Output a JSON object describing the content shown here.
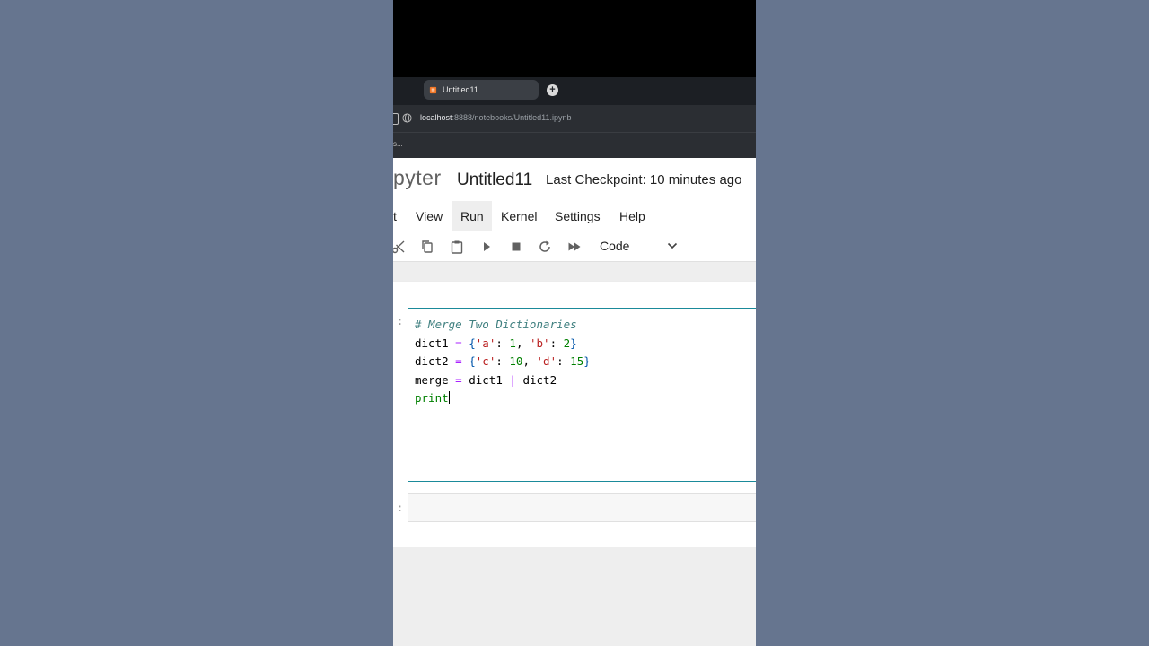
{
  "browser": {
    "tab_title": "Untitled11",
    "new_tab_symbol": "+",
    "url_host": "localhost",
    "url_path": ":8888/notebooks/Untitled11.ipynb",
    "bookmark_text": "s..."
  },
  "jupyter": {
    "logo_text": "pyter",
    "notebook_title": "Untitled11",
    "checkpoint": "Last Checkpoint: 10 minutes ago",
    "menu": {
      "edit_partial": "t",
      "view": "View",
      "run": "Run",
      "kernel": "Kernel",
      "settings": "Settings",
      "help": "Help"
    },
    "toolbar": {
      "cell_type": "Code",
      "icons": [
        "cut-icon",
        "copy-icon",
        "paste-icon",
        "run-icon",
        "stop-icon",
        "restart-icon",
        "fast-forward-icon",
        "chevron-down-icon"
      ]
    },
    "cells": {
      "prompt1": ":",
      "prompt2": ":",
      "code": {
        "l1_comment": "# Merge Two Dictionaries",
        "l2_name": "dict1",
        "l2_eq": "=",
        "l2_open": "{",
        "l2_k1": "'a'",
        "l2_colon1": ":",
        "l2_v1": "1",
        "l2_comma": ",",
        "l2_k2": "'b'",
        "l2_colon2": ":",
        "l2_v2": "2",
        "l2_close": "}",
        "l3_name": "dict2",
        "l3_eq": "=",
        "l3_open": "{",
        "l3_k1": "'c'",
        "l3_colon1": ":",
        "l3_v1": "10",
        "l3_comma": ",",
        "l3_k2": "'d'",
        "l3_colon2": ":",
        "l3_v2": "15",
        "l3_close": "}",
        "l4_name": "merge",
        "l4_eq": "=",
        "l4_a": "dict1",
        "l4_op": "|",
        "l4_b": "dict2",
        "l5_text": "print"
      }
    }
  },
  "colors": {
    "page_background": "#66758f",
    "cell_border_active": "#1a8a9a",
    "comment": "#408080",
    "operator": "#aa22ff",
    "string": "#ba2121",
    "number": "#008000"
  }
}
